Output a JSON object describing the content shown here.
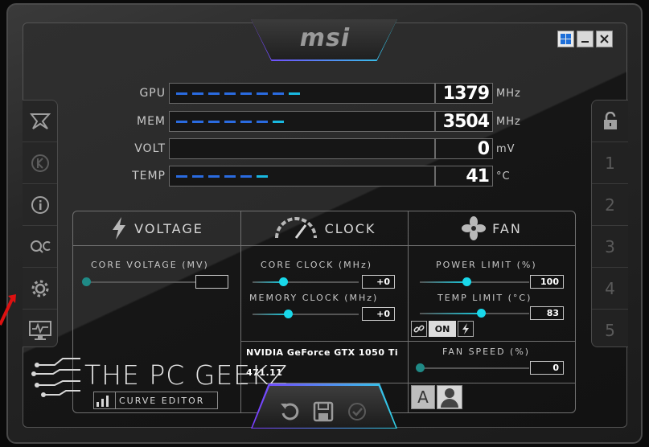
{
  "brand": {
    "logo_text": "msi"
  },
  "metrics": [
    {
      "label": "GPU",
      "value": "1379",
      "unit": "MHz",
      "dashes": 8,
      "fill_fraction": 0.55
    },
    {
      "label": "MEM",
      "value": "3504",
      "unit": "MHz",
      "dashes": 7,
      "fill_fraction": 0.47
    },
    {
      "label": "VOLT",
      "value": "0",
      "unit": "mV",
      "dashes": 0,
      "fill_fraction": 0
    },
    {
      "label": "TEMP",
      "value": "41",
      "unit": "°C",
      "dashes": 6,
      "fill_fraction": 0.41
    }
  ],
  "voltage": {
    "title": "VOLTAGE",
    "core_voltage_label": "CORE VOLTAGE  (MV)",
    "core_voltage_value": ""
  },
  "clock": {
    "title": "CLOCK",
    "core_clock_label": "CORE CLOCK (MHz)",
    "core_clock_value": "+0",
    "memory_clock_label": "MEMORY CLOCK (MHz)",
    "memory_clock_value": "+0"
  },
  "fan": {
    "title": "FAN",
    "power_limit_label": "POWER LIMIT (%)",
    "power_limit_value": "100",
    "temp_limit_label": "TEMP LIMIT (°C)",
    "temp_limit_value": "83",
    "link_on_label": "ON",
    "fan_speed_label": "FAN SPEED (%)",
    "fan_speed_value": "0"
  },
  "gpu": {
    "name": "NVIDIA GeForce GTX 1050 Ti",
    "driver": "471.11"
  },
  "profiles": [
    "1",
    "2",
    "3",
    "4",
    "5"
  ],
  "watermark": {
    "text": "THE PC GEEKZ"
  },
  "curve_editor_label": "CURVE EDITOR",
  "auto_button_label": "A",
  "colors": {
    "accent": "#19c8dc",
    "bar": "#2a6be0",
    "frame": "#2a2a2a"
  }
}
